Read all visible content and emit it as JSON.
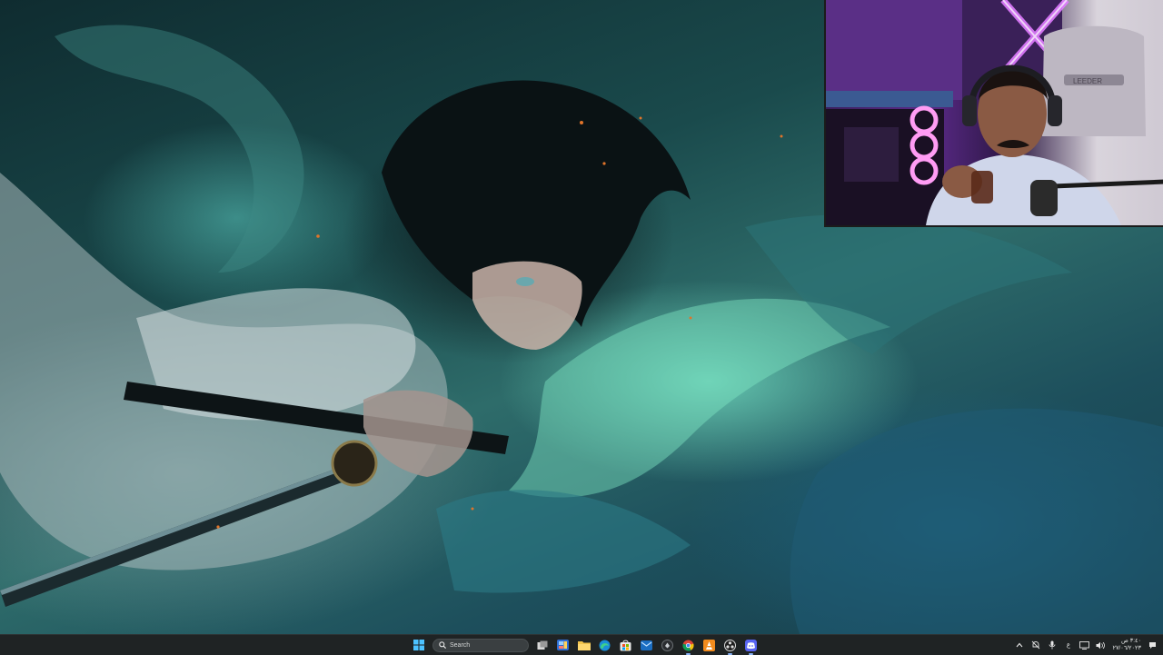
{
  "desktop": {
    "wallpaper": "anime swordsman with teal water dragon",
    "palette": {
      "deep": "#0f2c30",
      "teal": "#2e6c6a",
      "glow": "#78e6c8",
      "ember": "#e0742a"
    }
  },
  "webcam": {
    "chair_brand": "LEEDER",
    "light_color": "#c85cff"
  },
  "taskbar": {
    "search_placeholder": "Search",
    "apps": [
      {
        "name": "task-view",
        "icon": "task-view-icon"
      },
      {
        "name": "widgets",
        "icon": "widgets-icon"
      },
      {
        "name": "file-explorer",
        "icon": "folder-icon"
      },
      {
        "name": "edge",
        "icon": "edge-icon"
      },
      {
        "name": "store",
        "icon": "store-icon"
      },
      {
        "name": "outlook",
        "icon": "mail-icon"
      },
      {
        "name": "app-dark",
        "icon": "app-dark-icon"
      },
      {
        "name": "chrome",
        "icon": "chrome-icon"
      },
      {
        "name": "vlc-like",
        "icon": "cone-icon"
      },
      {
        "name": "obs",
        "icon": "record-icon"
      },
      {
        "name": "discord",
        "icon": "discord-icon"
      }
    ],
    "tray": {
      "language": "ع",
      "time": "٣:٤٠ ص",
      "date": "٢٧/٠٦/٢٠٢٣"
    }
  }
}
